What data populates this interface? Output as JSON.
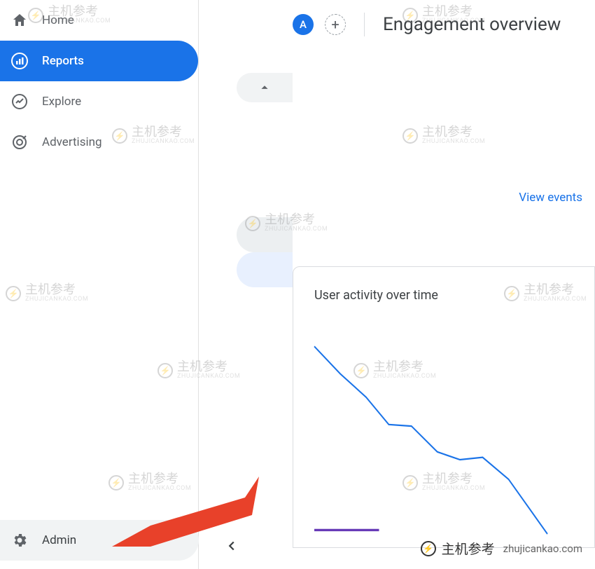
{
  "sidebar": {
    "items": [
      {
        "label": "Home",
        "icon": "home"
      },
      {
        "label": "Reports",
        "icon": "bar-chart",
        "active": true
      },
      {
        "label": "Explore",
        "icon": "trend"
      },
      {
        "label": "Advertising",
        "icon": "target"
      }
    ],
    "admin": {
      "label": "Admin",
      "icon": "gear"
    }
  },
  "header": {
    "avatar": "A",
    "page_title": "Engagement overview"
  },
  "link": {
    "view_events": "View events"
  },
  "card": {
    "title": "User activity over time"
  },
  "chart_data": {
    "type": "line",
    "title": "User activity over time",
    "x": [
      0,
      1,
      2,
      3,
      4,
      5,
      6,
      7,
      8,
      9
    ],
    "series": [
      {
        "name": "series-blue",
        "color": "#1a73e8",
        "values": [
          100,
          85,
          72,
          60,
          60,
          45,
          40,
          41,
          30,
          5
        ]
      },
      {
        "name": "series-purple",
        "color": "#673ab7",
        "values": [
          2,
          2,
          2,
          2,
          2,
          2,
          2,
          2,
          2,
          2
        ]
      }
    ],
    "ylim": [
      0,
      100
    ]
  },
  "watermark": {
    "big": "主机参考",
    "small": "ZHUJICANKAO.COM",
    "domain": "zhujicankao.com"
  }
}
